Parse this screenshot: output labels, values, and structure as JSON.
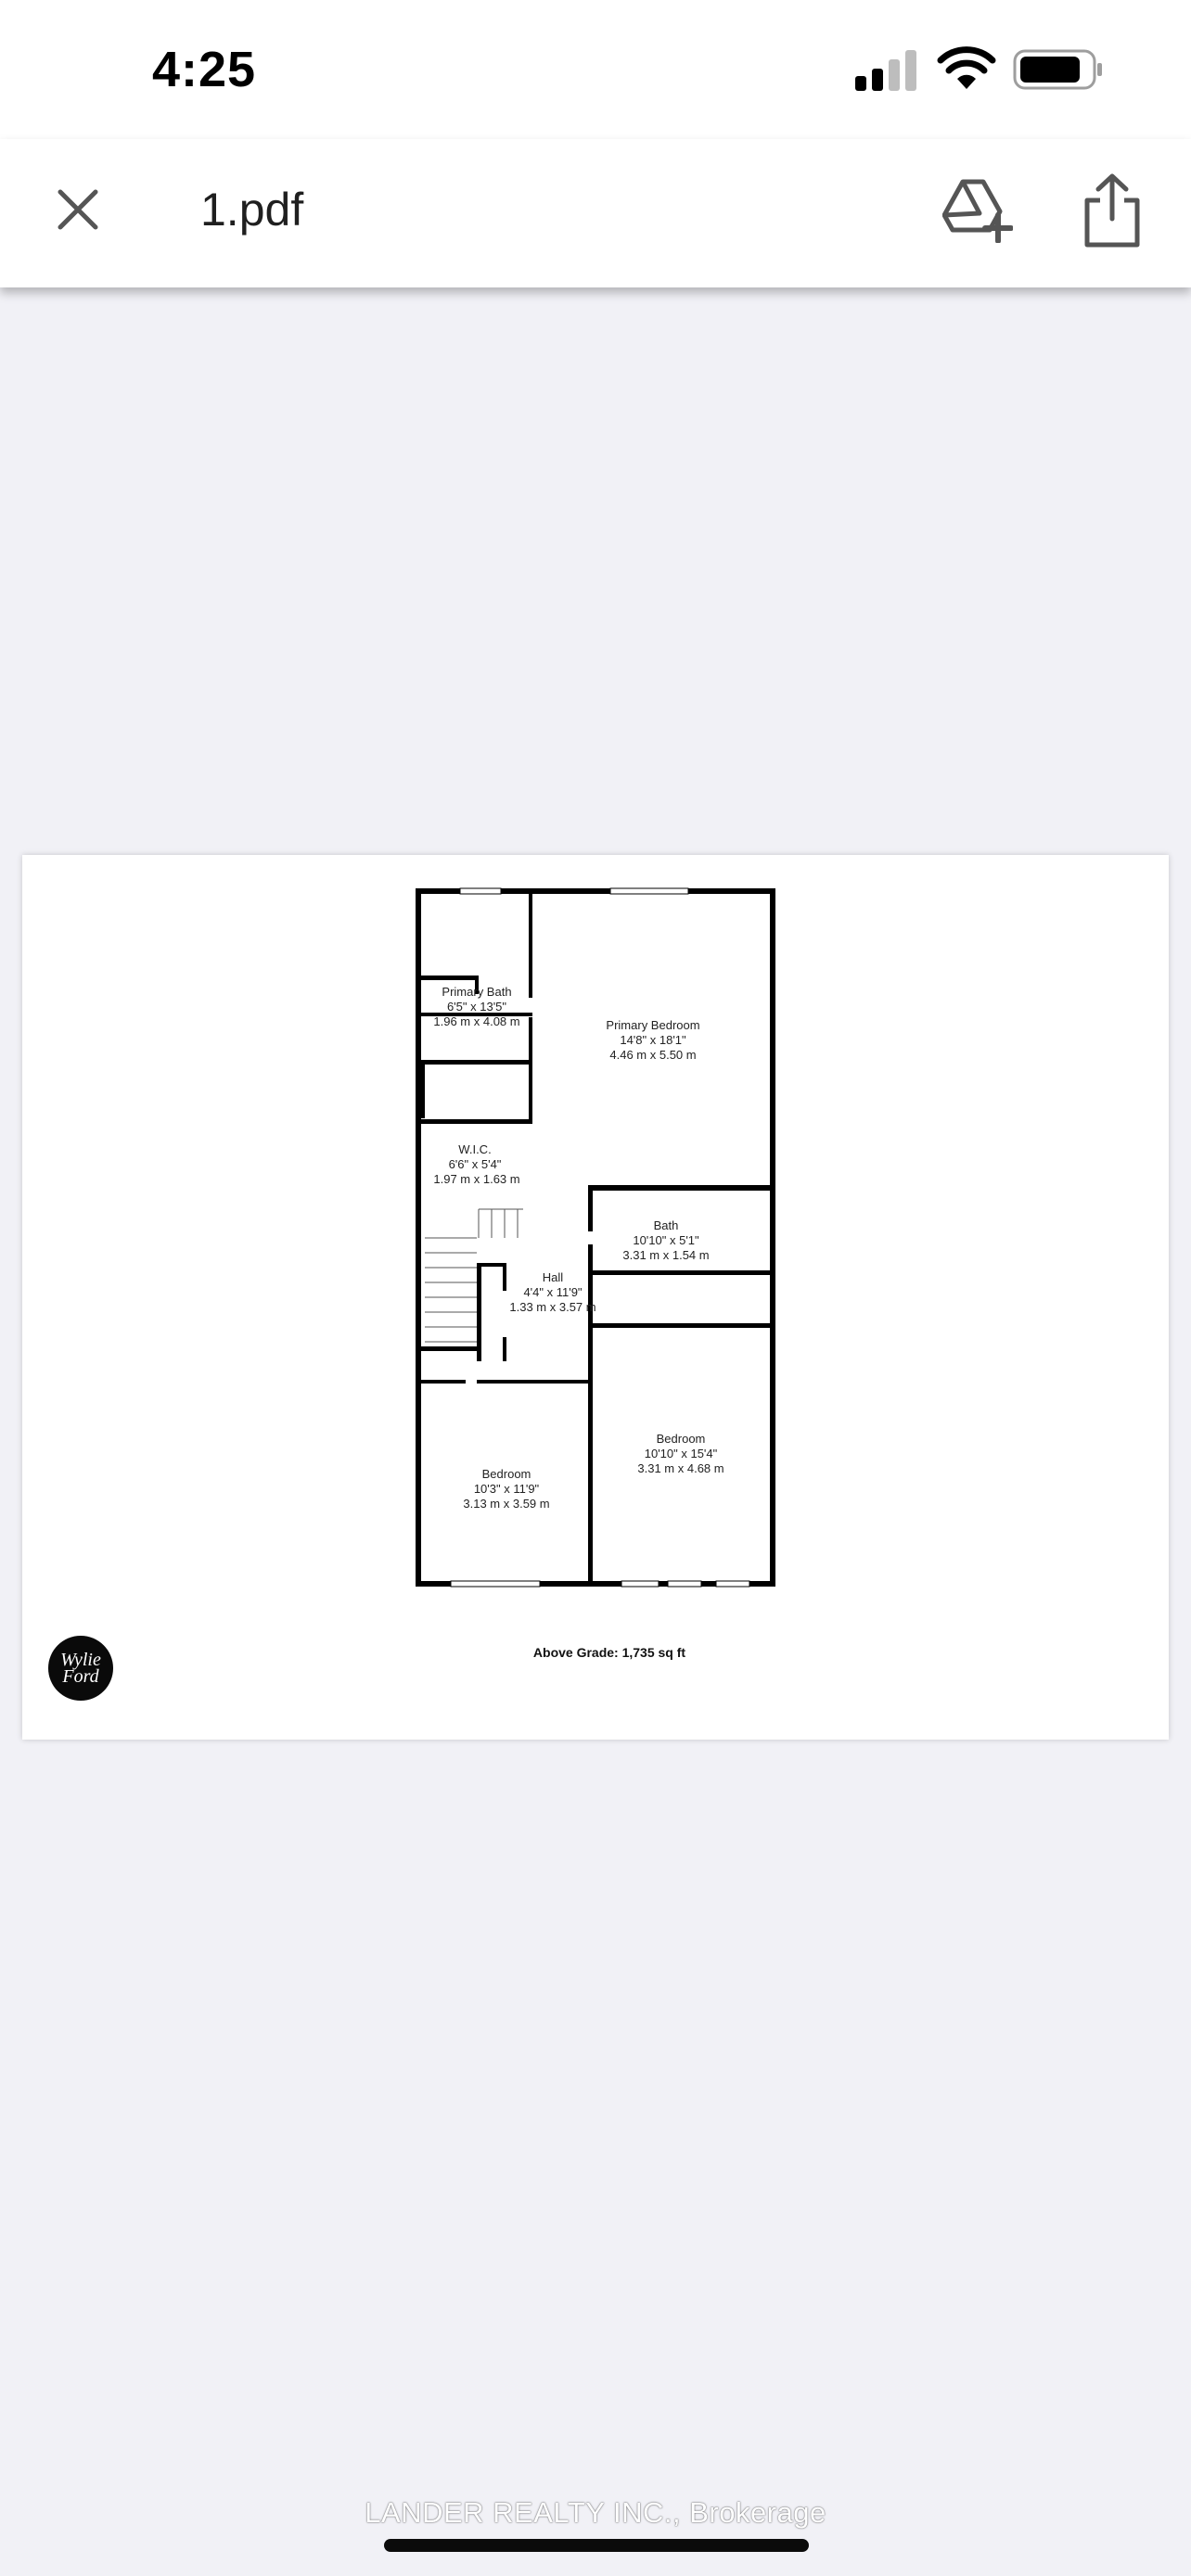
{
  "status_bar": {
    "time": "4:25"
  },
  "toolbar": {
    "title": "1.pdf"
  },
  "floorplan": {
    "rooms": [
      {
        "id": "primary-bath",
        "name": "Primary Bath",
        "imperial": "6'5\" x 13'5\"",
        "metric": "1.96 m x 4.08 m"
      },
      {
        "id": "primary-bedroom",
        "name": "Primary Bedroom",
        "imperial": "14'8\" x 18'1\"",
        "metric": "4.46 m x 5.50 m"
      },
      {
        "id": "wic",
        "name": "W.I.C.",
        "imperial": "6'6\" x 5'4\"",
        "metric": "1.97 m x 1.63 m"
      },
      {
        "id": "bath",
        "name": "Bath",
        "imperial": "10'10\" x 5'1\"",
        "metric": "3.31 m x 1.54 m"
      },
      {
        "id": "hall",
        "name": "Hall",
        "imperial": "4'4\" x 11'9\"",
        "metric": "1.33 m x 3.57 m"
      },
      {
        "id": "bedroom-2",
        "name": "Bedroom",
        "imperial": "10'10\" x 15'4\"",
        "metric": "3.31 m x 4.68 m"
      },
      {
        "id": "bedroom-3",
        "name": "Bedroom",
        "imperial": "10'3\" x 11'9\"",
        "metric": "3.13 m x 3.59 m"
      }
    ],
    "above_grade": "Above Grade: 1,735 sq ft"
  },
  "logo": {
    "text": "Wylie Ford"
  },
  "watermark": "LANDER REALTY INC., Brokerage",
  "icons": {
    "close": "close-icon",
    "drive": "add-to-drive-icon",
    "share": "share-icon",
    "signal": "cellular-signal-icon",
    "wifi": "wifi-icon",
    "battery": "battery-icon"
  }
}
